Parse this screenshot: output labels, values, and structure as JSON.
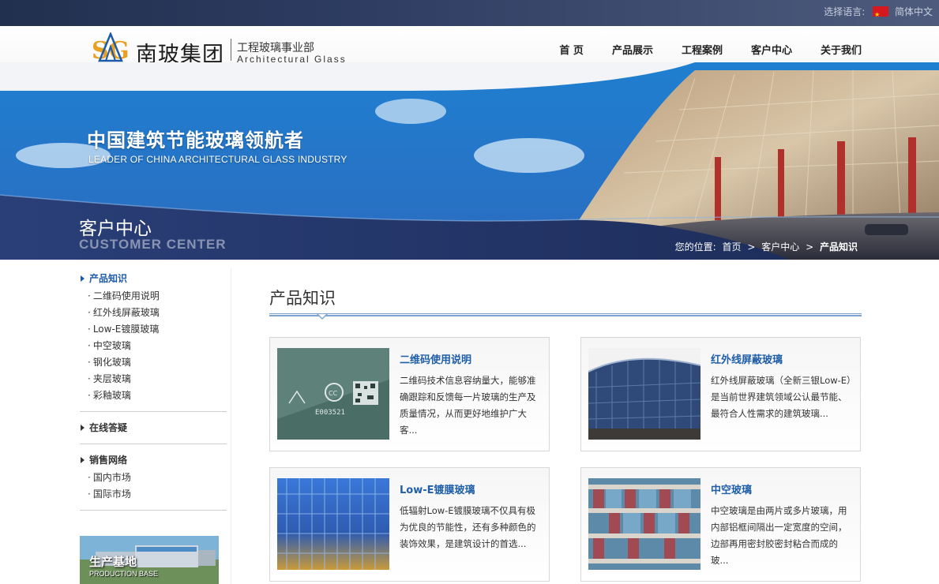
{
  "topbar": {
    "language_label": "选择语言:",
    "language_value": "简体中文"
  },
  "header": {
    "logo_cn": "南玻集团",
    "logo_sub_cn": "工程玻璃事业部",
    "logo_sub_en": "Architectural Glass",
    "nav": [
      "首 页",
      "产品展示",
      "工程案例",
      "客户中心",
      "关于我们"
    ]
  },
  "banner": {
    "slogan_cn": "中国建筑节能玻璃领航者",
    "slogan_en": "LEADER OF CHINA ARCHITECTURAL GLASS INDUSTRY",
    "page_title_cn": "客户中心",
    "page_title_en": "CUSTOMER CENTER",
    "breadcrumb": {
      "label": "您的位置:",
      "items": [
        "首页",
        "客户中心",
        "产品知识"
      ],
      "sep": ">"
    }
  },
  "sidebar": {
    "sections": [
      {
        "title": "产品知识",
        "items": [
          "二维码使用说明",
          "红外线屏蔽玻璃",
          "Low-E镀膜玻璃",
          "中空玻璃",
          "钢化玻璃",
          "夹层玻璃",
          "彩釉玻璃"
        ]
      },
      {
        "title": "在线答疑",
        "items": []
      },
      {
        "title": "销售网络",
        "items": [
          "国内市场",
          "国际市场"
        ]
      }
    ],
    "production_base_cn": "生产基地",
    "production_base_en": "PRODUCTION BASE"
  },
  "main": {
    "title": "产品知识",
    "cards": [
      {
        "title": "二维码使用说明",
        "desc": "二维码技术信息容纳量大，能够准确跟踪和反馈每一片玻璃的生产及质量情况，从而更好地维护广大客...",
        "image": "qr-glass-image"
      },
      {
        "title": "红外线屏蔽玻璃",
        "desc": "红外线屏蔽玻璃（全新三银Low-E）是当前世界建筑领域公认最节能、最符合人性需求的建筑玻璃...",
        "image": "curtain-wall-building-image"
      },
      {
        "title": "Low-E镀膜玻璃",
        "desc": "低辐射Low-E镀膜玻璃不仅具有极为优良的节能性，还有多种颜色的装饰效果，是建筑设计的首选...",
        "image": "lowe-glass-facade-image"
      },
      {
        "title": "中空玻璃",
        "desc": "中空玻璃是由两片或多片玻璃，用内部铝框间隔出一定宽度的空间，边部再用密封胶密封粘合而成的玻...",
        "image": "insulating-glass-facade-image"
      }
    ]
  },
  "colors": {
    "accent_blue": "#1f5ea8",
    "banner_blue": "#2e66b4",
    "topbar_navy": "#22304f"
  }
}
